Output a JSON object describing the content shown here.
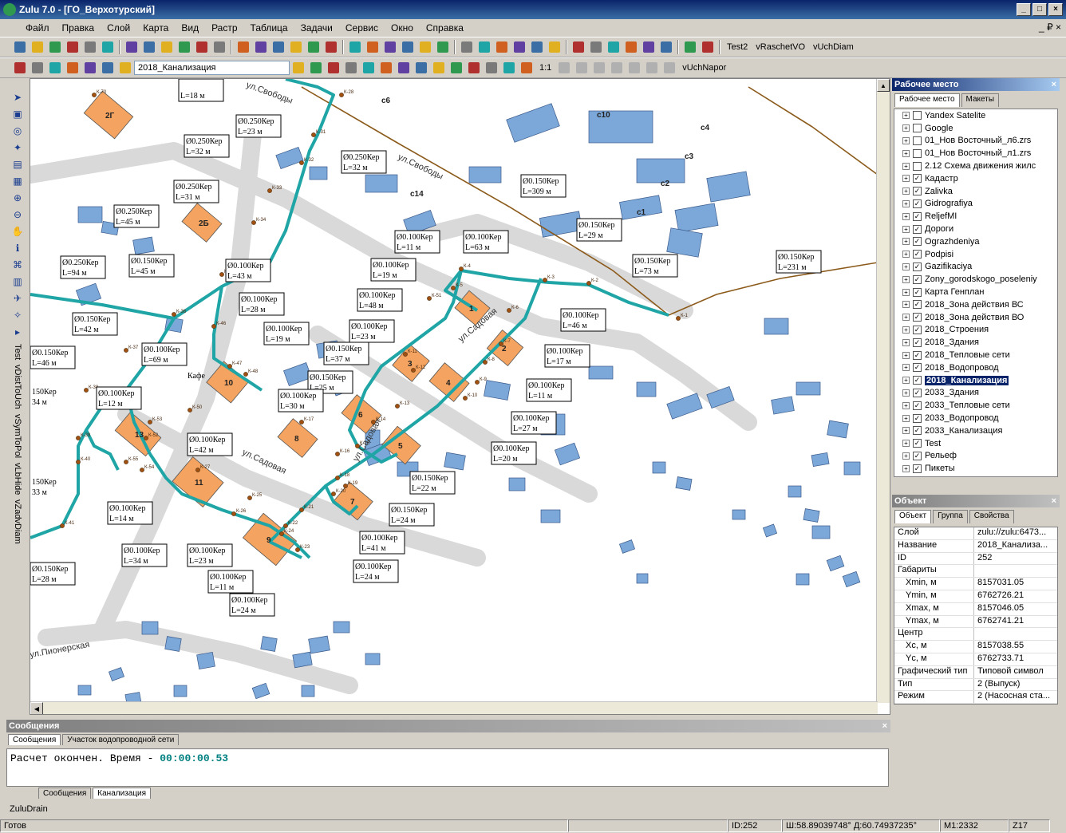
{
  "window": {
    "title": "Zulu 7.0 - [ГО_Верхотурский]",
    "controls": [
      "_",
      "□",
      "×"
    ]
  },
  "menu": [
    "Файл",
    "Правка",
    "Слой",
    "Карта",
    "Вид",
    "Растр",
    "Таблица",
    "Задачи",
    "Сервис",
    "Окно",
    "Справка"
  ],
  "menu_right": "_ ₽ ×",
  "toolbar1": {
    "items": [
      "Test2",
      "vRaschetVO",
      "vUchDiam"
    ]
  },
  "toolbar2": {
    "layer_combo": "2018_Канализация",
    "scale_label": "1:1",
    "right_label": "vUchNapor"
  },
  "left_vertical": [
    "Test",
    "vDistToUch",
    "vSymToPol",
    "vLbHide",
    "vZadvDiam"
  ],
  "map": {
    "streets": [
      "ул.Свободы",
      "ул.Свободы",
      "ул.Садовая",
      "ул.Садовая",
      "ул.Садовая",
      "ул.Пионерская"
    ],
    "building_numbers": [
      "1",
      "2",
      "3",
      "4",
      "6",
      "5",
      "7",
      "8",
      "9",
      "10",
      "11",
      "13",
      "2Г",
      "2Б",
      "с1",
      "с2",
      "с3",
      "с4",
      "с6",
      "с10",
      "с14"
    ],
    "nodes": [
      "К-1",
      "К-2",
      "К-3",
      "К-4",
      "К-5",
      "К-6",
      "К-7",
      "К-8",
      "К-9",
      "К-10",
      "К-11",
      "К-12",
      "К-13",
      "К-14",
      "К-15",
      "К-16",
      "К-17",
      "К-18",
      "К-19",
      "К-20",
      "К-21",
      "К-22",
      "К-23",
      "К-24",
      "К-25",
      "К-26",
      "К-27",
      "К-28",
      "К-31",
      "К-32",
      "К-33",
      "К-34",
      "К-35",
      "К-36",
      "К-37",
      "К-38",
      "К-39",
      "К-40",
      "К-41",
      "К-46",
      "К-47",
      "К-48",
      "К-50",
      "К-51",
      "К-52",
      "К-53",
      "К-54",
      "К-55",
      "К-70"
    ],
    "labels": [
      {
        "d": "Ø0.150Кер",
        "l": "L=231 м"
      },
      {
        "d": "Ø0.150Кер",
        "l": "L=73 м"
      },
      {
        "d": "Ø0.150Кер",
        "l": "L=29 м"
      },
      {
        "d": "Ø0.150Кер",
        "l": "L=309 м"
      },
      {
        "d": "Ø0.250Кер",
        "l": "L=23 м"
      },
      {
        "d": "Ø0.250Кер",
        "l": "L=32 м"
      },
      {
        "d": "Ø0.250Кер",
        "l": "L=32 м"
      },
      {
        "d": "Ø0.250Кер",
        "l": "L=31 м"
      },
      {
        "d": "Ø0.250Кер",
        "l": "L=45 м"
      },
      {
        "d": "Ø0.250Кер",
        "l": "L=94 м"
      },
      {
        "d": "Ø0.150Кер",
        "l": "L=45 м"
      },
      {
        "d": "Ø0.100Кер",
        "l": "L=43 м"
      },
      {
        "d": "Ø0.100Кер",
        "l": "L=11 м"
      },
      {
        "d": "Ø0.100Кер",
        "l": "L=63 м"
      },
      {
        "d": "Ø0.100Кер",
        "l": "L=19 м"
      },
      {
        "d": "Ø0.100Кер",
        "l": "L=48 м"
      },
      {
        "d": "Ø0.100Кер",
        "l": "L=23 м"
      },
      {
        "d": "Ø0.100Кер",
        "l": "L=46 м"
      },
      {
        "d": "Ø0.100Кер",
        "l": "L=17 м"
      },
      {
        "d": "Ø0.100Кер",
        "l": "L=11 м"
      },
      {
        "d": "Ø0.100Кер",
        "l": "L=27 м"
      },
      {
        "d": "Ø0.100Кер",
        "l": "L=20 м"
      },
      {
        "d": "Ø0.150Кер",
        "l": "L=22 м"
      },
      {
        "d": "Ø0.150Кер",
        "l": "L=24 м"
      },
      {
        "d": "Ø0.100Кер",
        "l": "L=41 м"
      },
      {
        "d": "Ø0.100Кер",
        "l": "L=24 м"
      },
      {
        "d": "Ø0.100Кер",
        "l": "L=28 м"
      },
      {
        "d": "Ø0.100Кер",
        "l": "L=19 м"
      },
      {
        "d": "Ø0.150Кер",
        "l": "L=37 м"
      },
      {
        "d": "Ø0.150Кер",
        "l": "L=25 м"
      },
      {
        "d": "Ø0.100Кер",
        "l": "L=30 м"
      },
      {
        "d": "Ø0.150Кер",
        "l": "L=42 м"
      },
      {
        "d": "Ø0.100Кер",
        "l": "L=69 м"
      },
      {
        "d": "Ø0.150Кер",
        "l": "L=46 м"
      },
      {
        "d": "Ø0.100Кер",
        "l": "L=12 м"
      },
      {
        "d": "Ø0.100Кер",
        "l": "L=42 м"
      },
      {
        "d": "Ø0.100Кер",
        "l": "L=14 м"
      },
      {
        "d": "Ø0.100Кер",
        "l": "L=34 м"
      },
      {
        "d": "Ø0.100Кер",
        "l": "L=23 м"
      },
      {
        "d": "Ø0.100Кер",
        "l": "L=11 м"
      },
      {
        "d": "Ø0.100Кер",
        "l": "L=24 м"
      },
      {
        "d": "Ø0.150Кер",
        "l": "L=28 м"
      },
      {
        "d": "Ø0.100Кер",
        "l": "L=19 м"
      },
      {
        "d": "",
        "l": "L=18 м"
      }
    ],
    "partial_labels": [
      "150Кер",
      "34 м",
      "150Кер",
      "33 м",
      "Кафе"
    ]
  },
  "workspace": {
    "title": "Рабочее место",
    "tabs": [
      "Рабочее место",
      "Макеты"
    ],
    "layers": [
      "Yandex Satelite",
      "Google",
      "01_Нов Восточный_л6.zrs",
      "01_Нов Восточный_л1.zrs",
      "2.12 Схема движения жилс",
      "Кадастр",
      "Zalivka",
      "Gidrografiya",
      "ReljefMI",
      "Дороги",
      "Ograzhdeniya",
      "Podpisi",
      "Gazifikaciya",
      "Zony_gorodskogo_poseleniy",
      "Карта Генплан",
      "2018_Зона действия ВС",
      "2018_Зона действия ВО",
      "2018_Строения",
      "2018_Здания",
      "2018_Тепловые сети",
      "2018_Водопровод",
      "2018_Канализация",
      "2033_Здания",
      "2033_Тепловые сети",
      "2033_Водопровод",
      "2033_Канализация",
      "Test",
      "Рельеф",
      "Пикеты"
    ],
    "selected": "2018_Канализация"
  },
  "object": {
    "title": "Объект",
    "tabs": [
      "Объект",
      "Группа",
      "Свойства"
    ],
    "props": [
      {
        "k": "Слой",
        "v": "zulu://zulu:6473...",
        "ind": false
      },
      {
        "k": "Название",
        "v": "2018_Канализа...",
        "ind": false
      },
      {
        "k": "ID",
        "v": "252",
        "ind": false
      },
      {
        "k": "Габариты",
        "v": "",
        "ind": false
      },
      {
        "k": "Xmin, м",
        "v": "8157031.05",
        "ind": true
      },
      {
        "k": "Ymin, м",
        "v": "6762726.21",
        "ind": true
      },
      {
        "k": "Xmax, м",
        "v": "8157046.05",
        "ind": true
      },
      {
        "k": "Ymax, м",
        "v": "6762741.21",
        "ind": true
      },
      {
        "k": "Центр",
        "v": "",
        "ind": false
      },
      {
        "k": "Xc, м",
        "v": "8157038.55",
        "ind": true
      },
      {
        "k": "Yc, м",
        "v": "6762733.71",
        "ind": true
      },
      {
        "k": "Графический тип",
        "v": "Типовой символ",
        "ind": false
      },
      {
        "k": "Тип",
        "v": "2 (Выпуск)",
        "ind": false
      },
      {
        "k": "Режим",
        "v": "2 (Насосная ста...",
        "ind": false
      }
    ]
  },
  "messages": {
    "title": "Сообщения",
    "tabs": [
      "Сообщения",
      "Участок водопроводной сети"
    ],
    "text": "Расчет окончен. Время - ",
    "time": "00:00:00.53",
    "bottom_tabs": [
      "Сообщения",
      "Канализация"
    ]
  },
  "zuludrain": "ZuluDrain",
  "status": {
    "ready": "Готов",
    "id": "ID:252",
    "coords": "Ш:58.89039748° Д:60.74937235°",
    "scale": "М1:2332",
    "zoom": "Z17"
  },
  "colors": {
    "pipe": "#1fa5a5",
    "building": "#f4a460",
    "house": "#7ba7d9",
    "road": "#d9d9d9",
    "main_pipe": "#8b5a1a"
  }
}
